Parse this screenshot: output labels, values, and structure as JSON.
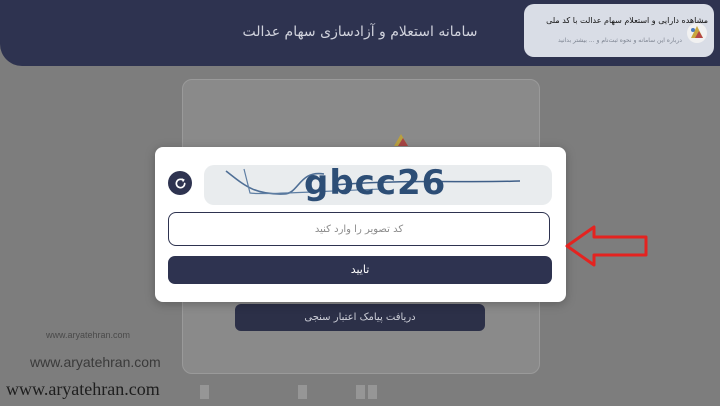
{
  "header": {
    "title": "سامانه استعلام و آزادسازی سهام عدالت"
  },
  "background": {
    "sms_button_label": "دریافت پیامک اعتبار سنجی"
  },
  "captcha": {
    "image_text": "gbcc26",
    "input_placeholder": "کد تصویر را وارد کنید",
    "confirm_label": "تایید"
  },
  "overlay": {
    "title": "مشاهده دارایی و استعلام سهام عدالت با کد ملی",
    "subtitle": "درباره این سامانه و نحوه ثبت‌نام و ... بیشتر بدانید"
  },
  "watermarks": {
    "small": "www.aryatehran.com",
    "mid": "www.aryatehran.com",
    "large": "www.aryatehran.com"
  },
  "colors": {
    "navy": "#2e3350",
    "arrow_red": "#e42320",
    "dim": "#7d7d7d"
  },
  "icons": {
    "refresh": "refresh-icon",
    "arrow": "red-arrow-icon"
  }
}
